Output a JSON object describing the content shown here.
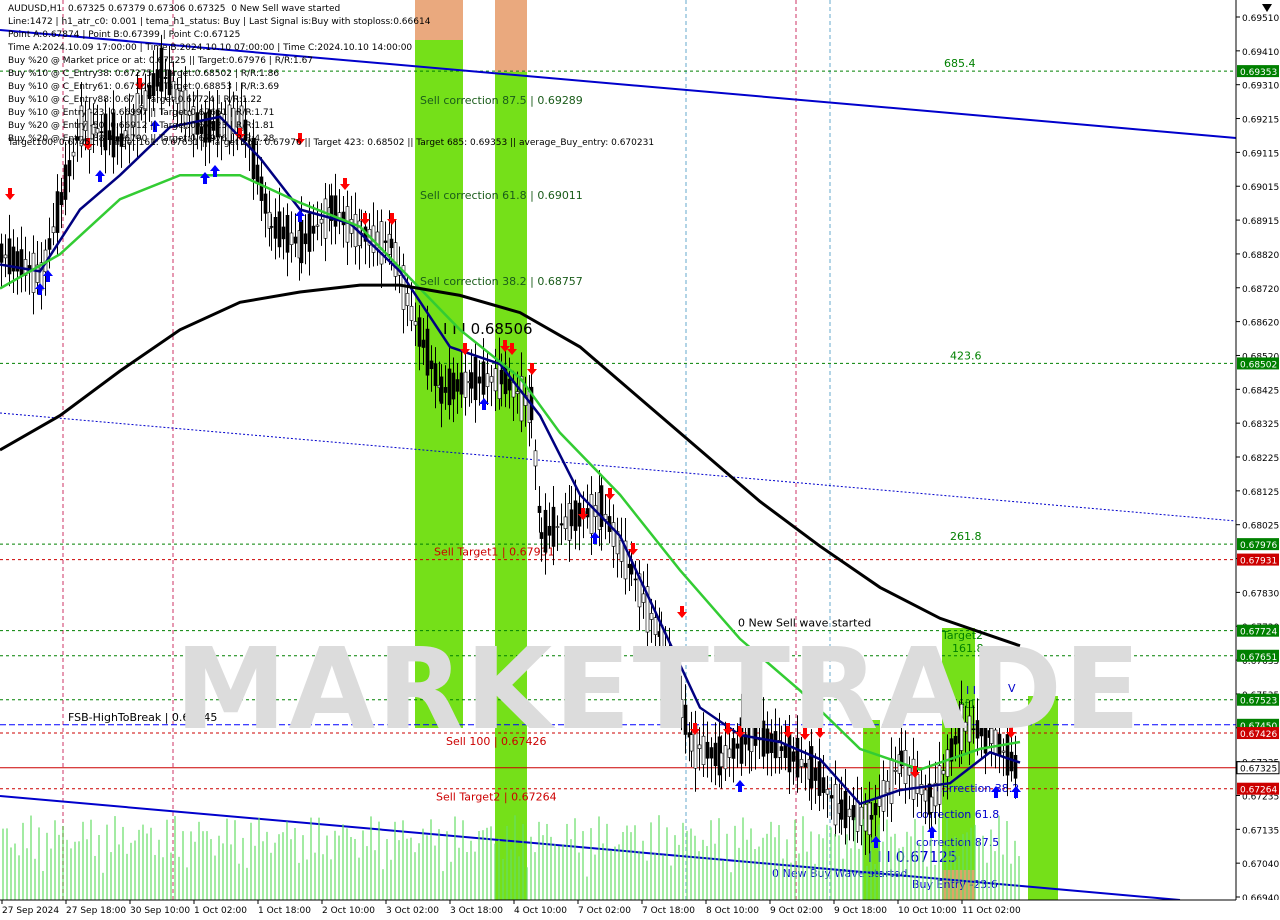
{
  "header": {
    "symbol": "AUDUSD,H1",
    "ohlc": "0.67325 0.67379 0.67306 0.67325",
    "status": "0 New Sell wave started",
    "lines": [
      "Line:1472 | h1_atr_c0: 0.001 | tema_h1_status: Buy | Last Signal is:Buy with stoploss:0.66614",
      "Point A:0.67874 | Point B:0.67399 | Point C:0.67125",
      "Time A:2024.10.09 17:00:00 | Time B:2024.10.10 07:00:00 | Time C:2024.10.10 14:00:00",
      "Buy %20 @ Market price or at: 0.67125 || Target:0.67976 | R/R:1.67",
      "Buy %10 @ C_Entry38: 0.67275 || Target:0.68502 | R/R:1.86",
      "Buy %10 @ C_Entry61: 0.67106 || Target:0.68853 | R/R:3.69",
      "Buy %10 @ C_Entry88: 0.67 || Target:0.67724 | R/R:1.22",
      "Buy %10 @ Entry -23: 0.66997 || Target:0.67651 | R/R:1.71",
      "Buy %20 @ Entry -50: 0.66912 || Target:0.67523 | R/R:1.81",
      "Buy %20 @ Entry -88: 0.66790 || Target:0.67976 | R/R:4.28",
      "Target100: 0.67451 || Target 161: 0.67651 || Target 261: 0.67976 || Target 423: 0.68502 || Target 685: 0.69353 || average_Buy_entry: 0.670231"
    ]
  },
  "watermark": "MARKETTRADE",
  "colors": {
    "background": "#ffffff",
    "blue_trend": "#0000cc",
    "fast_ma": "#000080",
    "mid_ma": "#33cc33",
    "slow_ma": "#000000",
    "green_zone": "#66dd00",
    "orange_zone": "#e8a070",
    "red_level": "#cc0000",
    "green_level": "#008000",
    "buy_arrow": "#0000ff",
    "sell_arrow": "#ff0000",
    "up_candle": "#000000",
    "volume": "#66dd66"
  },
  "chart_data": {
    "type": "line",
    "title": "AUDUSD,H1",
    "ylim": [
      0.6694,
      0.6956
    ],
    "price_axis": [
      "0.69510",
      "0.69410",
      "0.69310",
      "0.69215",
      "0.69115",
      "0.69015",
      "0.68915",
      "0.68820",
      "0.68720",
      "0.68620",
      "0.68520",
      "0.68425",
      "0.68325",
      "0.68225",
      "0.68125",
      "0.68025",
      "0.67930",
      "0.67830",
      "0.67730",
      "0.67635",
      "0.67535",
      "0.67435",
      "0.67335",
      "0.67235",
      "0.67135",
      "0.67040",
      "0.66940"
    ],
    "x_labels": [
      "27 Sep 2024",
      "27 Sep 18:00",
      "30 Sep 10:00",
      "1 Oct 02:00",
      "1 Oct 18:00",
      "2 Oct 10:00",
      "3 Oct 02:00",
      "3 Oct 18:00",
      "4 Oct 10:00",
      "7 Oct 02:00",
      "7 Oct 18:00",
      "8 Oct 10:00",
      "9 Oct 02:00",
      "9 Oct 18:00",
      "10 Oct 10:00",
      "11 Oct 02:00"
    ],
    "price_tags": [
      {
        "price": 0.69353,
        "label": "0.69353",
        "kind": "green"
      },
      {
        "price": 0.68502,
        "label": "0.68502",
        "kind": "green"
      },
      {
        "price": 0.67976,
        "label": "0.67976",
        "kind": "green"
      },
      {
        "price": 0.67931,
        "label": "0.67931",
        "kind": "red"
      },
      {
        "price": 0.67724,
        "label": "0.67724",
        "kind": "green"
      },
      {
        "price": 0.67651,
        "label": "0.67651",
        "kind": "green"
      },
      {
        "price": 0.67523,
        "label": "0.67523",
        "kind": "green"
      },
      {
        "price": 0.6745,
        "label": "0.67450",
        "kind": "green"
      },
      {
        "price": 0.67426,
        "label": "0.67426",
        "kind": "red"
      },
      {
        "price": 0.67325,
        "label": "0.67325",
        "kind": "current"
      },
      {
        "price": 0.67264,
        "label": "0.67264",
        "kind": "red"
      }
    ],
    "levels": [
      {
        "price": 0.69353,
        "label": "685.4",
        "kind": "green"
      },
      {
        "price": 0.68502,
        "label": "423.6",
        "kind": "green"
      },
      {
        "price": 0.67976,
        "label": "261.8",
        "kind": "green"
      },
      {
        "price": 0.67931,
        "label": "Sell Target1 | 0.67931",
        "kind": "red"
      },
      {
        "price": 0.67724,
        "label": "0 New Sell wave started",
        "kind": "green"
      },
      {
        "price": 0.67651,
        "label": "161.8",
        "kind": "green"
      },
      {
        "price": 0.67523,
        "label": "",
        "kind": "green"
      },
      {
        "price": 0.6745,
        "label": "FSB-HighToBreak | 0.67445",
        "kind": "blue"
      },
      {
        "price": 0.67426,
        "label": "Sell 100 | 0.67426",
        "kind": "red"
      },
      {
        "price": 0.67264,
        "label": "Sell Target2 | 0.67264",
        "kind": "red"
      }
    ],
    "annotations": [
      "Sell correction 87.5 | 0.69289",
      "Sell correction 61.8 | 0.69011",
      "Sell correction 38.2 | 0.68757",
      "I I I 0.68506",
      "Target2",
      "Target1",
      "correction 38.2",
      "correction 61.8",
      "correction 87.5",
      "I I I 0.67125",
      "0 New Buy Wave started",
      "Buy Entry -23.6",
      "V",
      "I I I"
    ],
    "current_price": 0.67325
  }
}
